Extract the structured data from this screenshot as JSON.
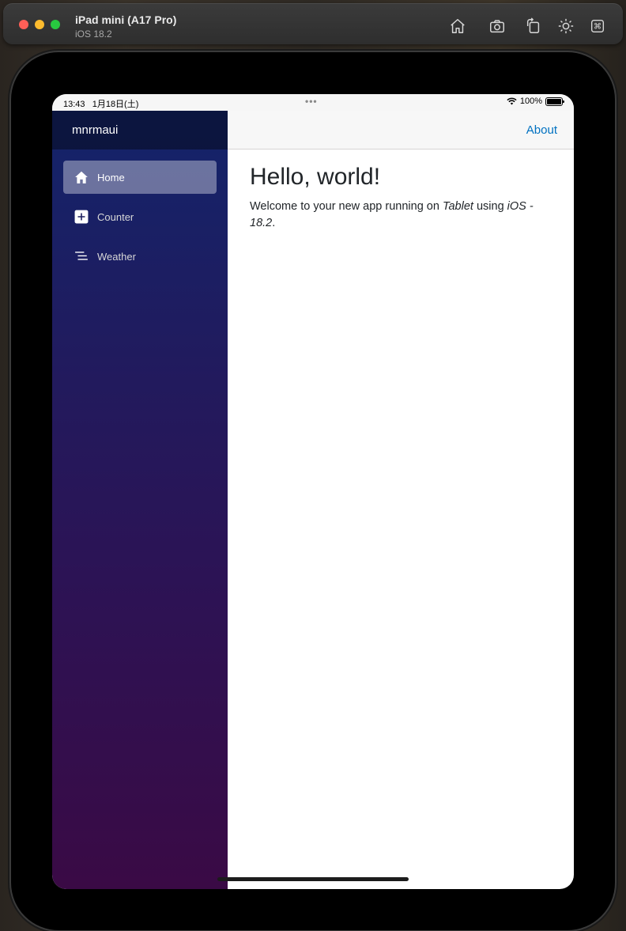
{
  "simulator": {
    "device_name": "iPad mini (A17 Pro)",
    "os_version": "iOS 18.2",
    "buttons": [
      "home-icon",
      "screenshot-icon",
      "rotate-icon",
      "appearance-icon",
      "command-icon"
    ]
  },
  "status_bar": {
    "time": "13:43",
    "date": "1月18日(土)",
    "dots": "•••",
    "battery": "100%"
  },
  "sidebar": {
    "app_title": "mnrmaui",
    "items": [
      {
        "label": "Home",
        "icon": "home-icon",
        "active": true
      },
      {
        "label": "Counter",
        "icon": "plus-square-icon",
        "active": false
      },
      {
        "label": "Weather",
        "icon": "list-icon",
        "active": false
      }
    ]
  },
  "top_row": {
    "about_label": "About"
  },
  "main": {
    "heading": "Hello, world!",
    "welcome_prefix": "Welcome to your new app running on ",
    "platform": "Tablet",
    "using": " using ",
    "os": "iOS - 18.2",
    "period": "."
  },
  "colors": {
    "sidebar_top": "#13246a",
    "sidebar_bottom": "#3a0a45",
    "link": "#0071c1"
  }
}
